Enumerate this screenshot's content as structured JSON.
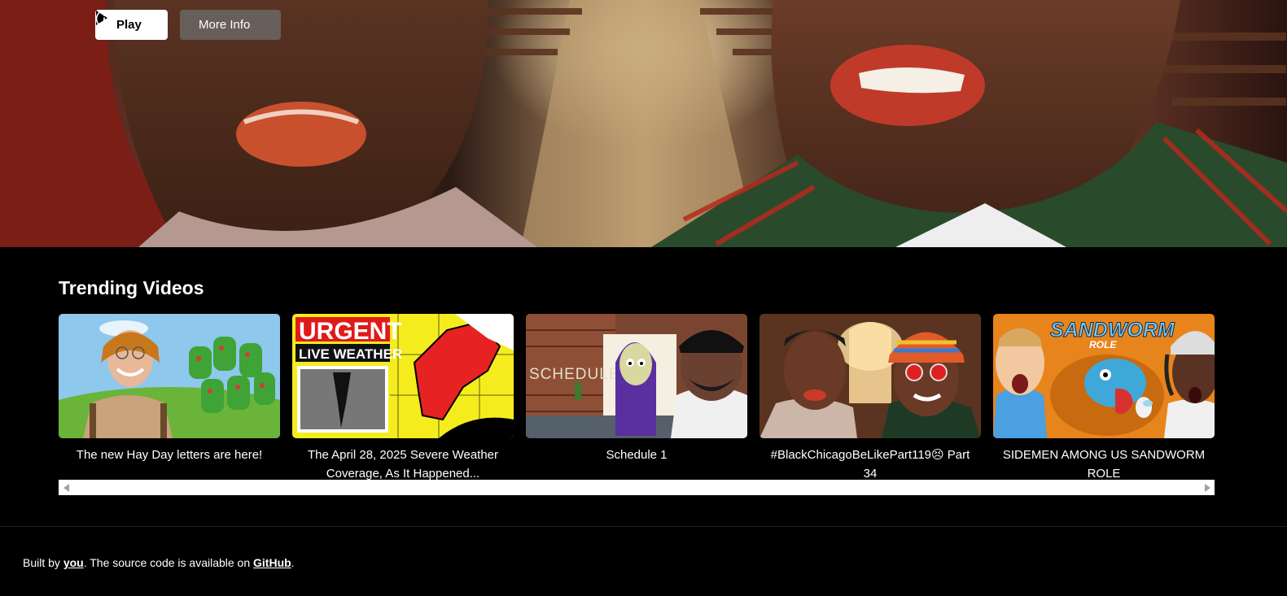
{
  "hero": {
    "play_label": "Play",
    "info_label": "More Info",
    "icons": {
      "play": "play-icon",
      "info": "info-circle-icon"
    }
  },
  "trending": {
    "title": "Trending Videos",
    "videos": [
      {
        "title": "The new Hay Day letters are here!"
      },
      {
        "title": "The April 28, 2025 Severe Weather Coverage, As It Happened...",
        "thumb_text_1": "URGENT",
        "thumb_text_2": "LIVE WEATHER"
      },
      {
        "title": "Schedule 1",
        "thumb_text": "SCHEDULE"
      },
      {
        "title": "#BlackChicagoBeLikePart119😣 Part 34"
      },
      {
        "title": "SIDEMEN AMONG US SANDWORM ROLE",
        "thumb_text_1": "SANDWORM",
        "thumb_text_2": "ROLE"
      }
    ]
  },
  "scrollbar": {
    "icons": {
      "left": "triangle-left-icon",
      "right": "triangle-right-icon"
    }
  },
  "footer": {
    "prefix": "Built by ",
    "link1": "you",
    "middle": ". The source code is available on ",
    "link2": "GitHub",
    "suffix": "."
  },
  "colors": {
    "background": "#000000",
    "button_light": "#ffffff",
    "button_muted": "#6e6e6e"
  }
}
